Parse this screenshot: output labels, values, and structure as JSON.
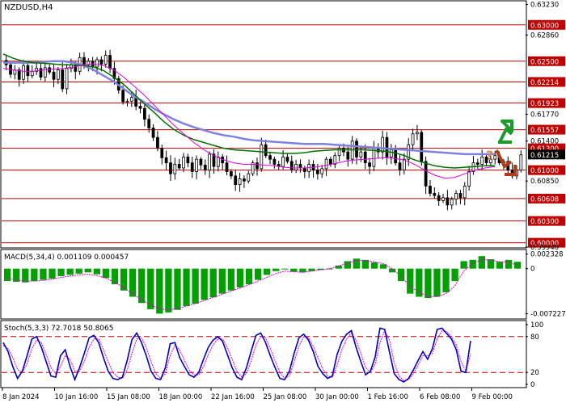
{
  "chart_data": [
    {
      "id": "price",
      "type": "candlestick",
      "title": "NZDUSD,H4",
      "ylim": [
        0.5994,
        0.6332
      ],
      "ticks": [
        0.6328,
        0.6286,
        0.625,
        0.62214,
        0.61923,
        0.6177,
        0.61557,
        0.614,
        0.613,
        0.61215,
        0.61,
        0.6085,
        0.60608,
        0.603,
        0.6,
        0.5994
      ],
      "tick_labels": [
        "0.63230",
        "0.62860",
        "0.62500",
        "0.62214",
        "0.61923",
        "0.61770",
        "0.61557",
        "0.61400",
        "0.61300",
        "0.61215",
        "0.61000",
        "0.60850",
        "0.60608",
        "0.60300",
        "0.60000",
        "0.59940"
      ],
      "levels": [
        {
          "value": 0.63,
          "label": "0.63000"
        },
        {
          "value": 0.625,
          "label": "0.62500"
        },
        {
          "value": 0.62214,
          "label": "0.62214"
        },
        {
          "value": 0.61923,
          "label": "0.61923"
        },
        {
          "value": 0.61557,
          "label": "0.61557"
        },
        {
          "value": 0.613,
          "label": "0.61300"
        },
        {
          "value": 0.61,
          "label": "0.61000"
        },
        {
          "value": 0.60608,
          "label": "0.60608"
        },
        {
          "value": 0.603,
          "label": "0.60300"
        },
        {
          "value": 0.6,
          "label": "0.60000"
        }
      ],
      "current_price": {
        "value": 0.61215,
        "label": "0.61215"
      },
      "close_path": [
        0.6245,
        0.6232,
        0.6238,
        0.6225,
        0.6244,
        0.623,
        0.6236,
        0.624,
        0.6228,
        0.6241,
        0.6235,
        0.6225,
        0.6238,
        0.6212,
        0.624,
        0.6245,
        0.6236,
        0.6255,
        0.6245,
        0.625,
        0.6242,
        0.6252,
        0.6246,
        0.6258,
        0.624,
        0.6226,
        0.621,
        0.6194,
        0.6195,
        0.62,
        0.6188,
        0.6185,
        0.617,
        0.6158,
        0.6145,
        0.613,
        0.6117,
        0.611,
        0.6095,
        0.6108,
        0.6103,
        0.6118,
        0.611,
        0.6098,
        0.6115,
        0.6107,
        0.61,
        0.6122,
        0.6105,
        0.6118,
        0.611,
        0.6098,
        0.6092,
        0.608,
        0.6088,
        0.6085,
        0.6095,
        0.611,
        0.6102,
        0.6135,
        0.612,
        0.6115,
        0.6108,
        0.6105,
        0.6118,
        0.6112,
        0.61,
        0.6108,
        0.6103,
        0.6098,
        0.6108,
        0.61,
        0.6095,
        0.6102,
        0.6115,
        0.6108,
        0.612,
        0.613,
        0.6125,
        0.6115,
        0.614,
        0.6118,
        0.6125,
        0.611,
        0.6105,
        0.613,
        0.6125,
        0.6145,
        0.6118,
        0.6128,
        0.611,
        0.61,
        0.6115,
        0.6135,
        0.615,
        0.6152,
        0.6112,
        0.6078,
        0.6068,
        0.6065,
        0.6058,
        0.6062,
        0.6052,
        0.606,
        0.6068,
        0.6062,
        0.6078,
        0.6098,
        0.611,
        0.6108,
        0.6118,
        0.611,
        0.6115,
        0.612,
        0.611,
        0.6112,
        0.61,
        0.6092,
        0.61,
        0.6121
      ],
      "ma_fast": [
        0.624,
        0.6238,
        0.6236,
        0.6236,
        0.6238,
        0.6239,
        0.624,
        0.6242,
        0.6245,
        0.6246,
        0.6244,
        0.6238,
        0.6228,
        0.6216,
        0.6204,
        0.619,
        0.6176,
        0.6162,
        0.615,
        0.6138,
        0.6128,
        0.612,
        0.6114,
        0.611,
        0.6108,
        0.6108,
        0.6107,
        0.6106,
        0.6104,
        0.6103,
        0.6103,
        0.6104,
        0.6106,
        0.6109,
        0.6112,
        0.6114,
        0.6115,
        0.6116,
        0.6117,
        0.6116,
        0.6114,
        0.6108,
        0.61,
        0.6093,
        0.6089,
        0.609,
        0.6095,
        0.61,
        0.6103,
        0.6105
      ],
      "ma_mid": [
        0.626,
        0.6254,
        0.625,
        0.6248,
        0.6247,
        0.6246,
        0.6245,
        0.6245,
        0.6244,
        0.6242,
        0.6237,
        0.6228,
        0.6218,
        0.6205,
        0.6192,
        0.618,
        0.6167,
        0.6156,
        0.6148,
        0.6142,
        0.6138,
        0.6134,
        0.613,
        0.6128,
        0.6127,
        0.6126,
        0.6125,
        0.6124,
        0.6123,
        0.6123,
        0.6124,
        0.6126,
        0.6127,
        0.6128,
        0.6128,
        0.6128,
        0.6128,
        0.6127,
        0.6126,
        0.6124,
        0.612,
        0.6114,
        0.611,
        0.6106,
        0.6104,
        0.6103,
        0.6104,
        0.6105,
        0.6106,
        0.6106
      ],
      "ma_slow": [
        0.6248,
        0.6248,
        0.6248,
        0.6248,
        0.6249,
        0.625,
        0.625,
        0.6248,
        0.6244,
        0.6238,
        0.623,
        0.6222,
        0.6212,
        0.6202,
        0.6194,
        0.6185,
        0.6177,
        0.617,
        0.6164,
        0.6159,
        0.6155,
        0.6151,
        0.6148,
        0.6146,
        0.6143,
        0.6141,
        0.614,
        0.6139,
        0.6138,
        0.6137,
        0.6136,
        0.6136,
        0.6136,
        0.6135,
        0.6134,
        0.6133,
        0.6132,
        0.6131,
        0.613,
        0.6129,
        0.6128,
        0.6127,
        0.6126,
        0.6125,
        0.6124,
        0.6123,
        0.6122,
        0.6122,
        0.6122,
        0.6122
      ],
      "x_labels": [
        "8 Jan 2024",
        "10 Jan 16:00",
        "15 Jan 08:00",
        "18 Jan 00:00",
        "22 Jan 16:00",
        "25 Jan 08:00",
        "30 Jan 00:00",
        "1 Feb 16:00",
        "6 Feb 08:00",
        "9 Feb 00:00"
      ],
      "forecast_marker": "?",
      "colors": {
        "bull": "#000000",
        "bear": "#000000",
        "level": "#c00000",
        "ma_fast": "#e000e0",
        "ma_mid": "#007000",
        "ma_slow": "#8080e0",
        "up_arrow": "#1a9a2a",
        "down_arrow": "#b03a1a",
        "price_box": "#000000"
      }
    },
    {
      "id": "macd",
      "type": "bar",
      "title": "MACD(5,34,4) 0.001109 0.000457",
      "ylim": [
        -0.0078,
        0.0028
      ],
      "tick_labels": [
        "0.002328",
        "0",
        "-0.007227"
      ],
      "ticks": [
        0.002328,
        0,
        -0.007227
      ],
      "histogram": [
        -0.002,
        -0.0021,
        -0.0022,
        -0.002,
        -0.0018,
        -0.0016,
        -0.0012,
        -0.001,
        -0.0008,
        -0.0006,
        -0.0009,
        -0.0015,
        -0.0025,
        -0.0035,
        -0.0045,
        -0.0055,
        -0.0065,
        -0.0072,
        -0.007,
        -0.0066,
        -0.006,
        -0.0056,
        -0.005,
        -0.0046,
        -0.004,
        -0.0035,
        -0.003,
        -0.0025,
        -0.0018,
        -0.001,
        -0.0004,
        0.0,
        -0.0005,
        -0.0006,
        -0.0004,
        -0.0002,
        0.0,
        0.0005,
        0.0012,
        0.0016,
        0.0014,
        0.001,
        0.0007,
        -0.0006,
        -0.002,
        -0.004,
        -0.0045,
        -0.0047,
        -0.0045,
        -0.0038,
        -0.002,
        0.0012,
        0.0014,
        0.002,
        0.0015,
        0.0011,
        0.0014,
        0.0011
      ],
      "signal": [
        -0.0015,
        -0.0018,
        -0.002,
        -0.002,
        -0.0019,
        -0.0017,
        -0.0014,
        -0.0012,
        -0.001,
        -0.0009,
        -0.0011,
        -0.0015,
        -0.0022,
        -0.003,
        -0.004,
        -0.005,
        -0.0058,
        -0.0064,
        -0.0066,
        -0.0064,
        -0.006,
        -0.0056,
        -0.0051,
        -0.0046,
        -0.0041,
        -0.0036,
        -0.0031,
        -0.0026,
        -0.002,
        -0.0014,
        -0.0008,
        -0.0004,
        -0.0005,
        -0.0006,
        -0.0004,
        -0.0002,
        0.0,
        0.0004,
        0.0009,
        0.0013,
        0.0013,
        0.0011,
        0.0008,
        0.0,
        -0.0012,
        -0.0028,
        -0.0038,
        -0.0044,
        -0.0045,
        -0.004,
        -0.0028,
        -0.0004,
        0.0008,
        0.0014,
        0.0014,
        0.0011,
        0.0011,
        0.0005
      ],
      "colors": {
        "bar": "#00a000",
        "signal": "#e000e0",
        "zero": "#000000"
      }
    },
    {
      "id": "stoch",
      "type": "line",
      "title": "Stoch(5,3,3) 72.7018 50.8065",
      "ylim": [
        0,
        100
      ],
      "ticks": [
        100,
        80,
        20,
        0
      ],
      "tick_labels": [
        "100",
        "80",
        "20",
        "0"
      ],
      "levels": [
        80,
        20
      ],
      "main": [
        70,
        55,
        30,
        10,
        22,
        48,
        76,
        80,
        62,
        38,
        14,
        12,
        48,
        58,
        30,
        8,
        28,
        52,
        78,
        82,
        70,
        45,
        22,
        10,
        8,
        12,
        40,
        75,
        86,
        70,
        48,
        22,
        10,
        8,
        28,
        68,
        70,
        45,
        30,
        16,
        12,
        20,
        42,
        62,
        74,
        80,
        72,
        50,
        28,
        12,
        8,
        28,
        56,
        82,
        86,
        70,
        48,
        28,
        10,
        8,
        22,
        52,
        78,
        84,
        74,
        55,
        30,
        18,
        10,
        14,
        50,
        72,
        84,
        90,
        62,
        38,
        16,
        22,
        46,
        94,
        92,
        54,
        18,
        8,
        4,
        10,
        24,
        40,
        55,
        42,
        60,
        92,
        94,
        85,
        76,
        58,
        22,
        20,
        73
      ],
      "signal": [
        65,
        60,
        45,
        25,
        20,
        35,
        60,
        74,
        70,
        50,
        28,
        18,
        30,
        48,
        42,
        22,
        22,
        38,
        62,
        76,
        76,
        58,
        38,
        20,
        12,
        10,
        24,
        52,
        76,
        78,
        62,
        38,
        18,
        10,
        18,
        48,
        66,
        58,
        40,
        24,
        16,
        16,
        30,
        50,
        66,
        76,
        76,
        62,
        42,
        22,
        12,
        18,
        40,
        66,
        80,
        78,
        60,
        40,
        20,
        10,
        14,
        38,
        64,
        80,
        78,
        64,
        44,
        26,
        14,
        12,
        32,
        58,
        76,
        86,
        74,
        52,
        28,
        20,
        34,
        70,
        90,
        74,
        36,
        14,
        6,
        8,
        18,
        32,
        48,
        48,
        52,
        76,
        90,
        88,
        80,
        66,
        38,
        22,
        51
      ],
      "colors": {
        "main": "#0000c0",
        "signal": "#e000e0",
        "level": "#c00000"
      }
    }
  ]
}
